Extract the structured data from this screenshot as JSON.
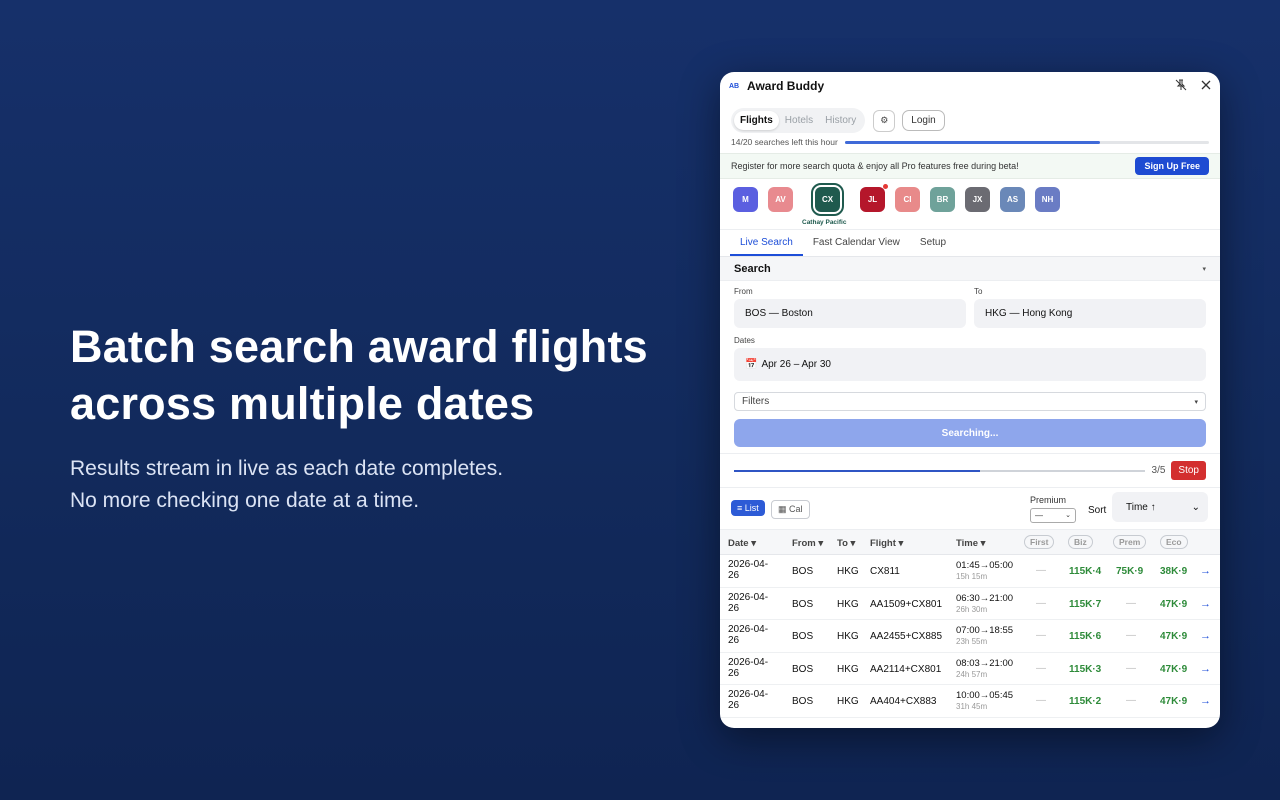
{
  "hero": {
    "title_line1": "Batch search award flights",
    "title_line2": "across multiple dates",
    "sub_line1": "Results stream in live as each date completes.",
    "sub_line2": "No more checking one date at a time."
  },
  "window": {
    "logo": "AB",
    "title": "Award Buddy",
    "pin_icon": "pin-off-icon",
    "close_icon": "close-icon"
  },
  "nav": {
    "tabs": [
      "Flights",
      "Hotels",
      "History"
    ],
    "active": "Flights",
    "gear": "⚙",
    "login": "Login"
  },
  "quota": {
    "text": "14/20 searches left this hour",
    "fraction": 0.7
  },
  "banner": {
    "text": "Register for more search quota & enjoy all Pro features free during beta!",
    "button": "Sign Up Free"
  },
  "airlines": [
    {
      "code": "M",
      "color": "#5b5fe0"
    },
    {
      "code": "AV",
      "color": "#e88a8f"
    },
    {
      "code": "CX",
      "color": "#1f5a4e",
      "selected": true,
      "label": "Cathay Pacific"
    },
    {
      "code": "JL",
      "color": "#b5172b",
      "dot": true
    },
    {
      "code": "CI",
      "color": "#e88a8a"
    },
    {
      "code": "BR",
      "color": "#6fa29a"
    },
    {
      "code": "JX",
      "color": "#6b6b72"
    },
    {
      "code": "AS",
      "color": "#6a88b8"
    },
    {
      "code": "NH",
      "color": "#6a7cc4"
    }
  ],
  "subtabs": [
    "Live Search",
    "Fast Calendar View",
    "Setup"
  ],
  "search": {
    "section": "Search",
    "from_label": "From",
    "from_value": "BOS — Boston",
    "to_label": "To",
    "to_value": "HKG — Hong Kong",
    "dates_label": "Dates",
    "dates_value": "Apr 26 – Apr 30",
    "dates_icon": "📅",
    "filters": "Filters",
    "button": "Searching..."
  },
  "progress": {
    "done": 3,
    "total": 5,
    "text": "3/5",
    "stop": "Stop"
  },
  "view": {
    "list": "≡ List",
    "cal": "▦ Cal",
    "premium_label": "Premium",
    "premium_value": "—",
    "sort_label": "Sort",
    "sort_value": "Time ↑"
  },
  "table": {
    "headers": {
      "date": "Date ▾",
      "from": "From ▾",
      "to": "To ▾",
      "flight": "Flight ▾",
      "time": "Time ▾",
      "first": "First",
      "biz": "Biz",
      "prem": "Prem",
      "eco": "Eco"
    },
    "rows": [
      {
        "date": "2026-04-26",
        "from": "BOS",
        "to": "HKG",
        "flight": "CX811",
        "time": "01:45→05:00",
        "dur": "15h 15m",
        "first": "—",
        "biz": "115K·4",
        "prem": "75K·9",
        "eco": "38K·9"
      },
      {
        "date": "2026-04-26",
        "from": "BOS",
        "to": "HKG",
        "flight": "AA1509+CX801",
        "time": "06:30→21:00",
        "dur": "26h 30m",
        "first": "—",
        "biz": "115K·7",
        "prem": "—",
        "eco": "47K·9"
      },
      {
        "date": "2026-04-26",
        "from": "BOS",
        "to": "HKG",
        "flight": "AA2455+CX885",
        "time": "07:00→18:55",
        "dur": "23h 55m",
        "first": "—",
        "biz": "115K·6",
        "prem": "—",
        "eco": "47K·9"
      },
      {
        "date": "2026-04-26",
        "from": "BOS",
        "to": "HKG",
        "flight": "AA2114+CX801",
        "time": "08:03→21:00",
        "dur": "24h 57m",
        "first": "—",
        "biz": "115K·3",
        "prem": "—",
        "eco": "47K·9"
      },
      {
        "date": "2026-04-26",
        "from": "BOS",
        "to": "HKG",
        "flight": "AA404+CX883",
        "time": "10:00→05:45",
        "dur": "31h 45m",
        "first": "—",
        "biz": "115K·2",
        "prem": "—",
        "eco": "47K·9"
      }
    ]
  }
}
